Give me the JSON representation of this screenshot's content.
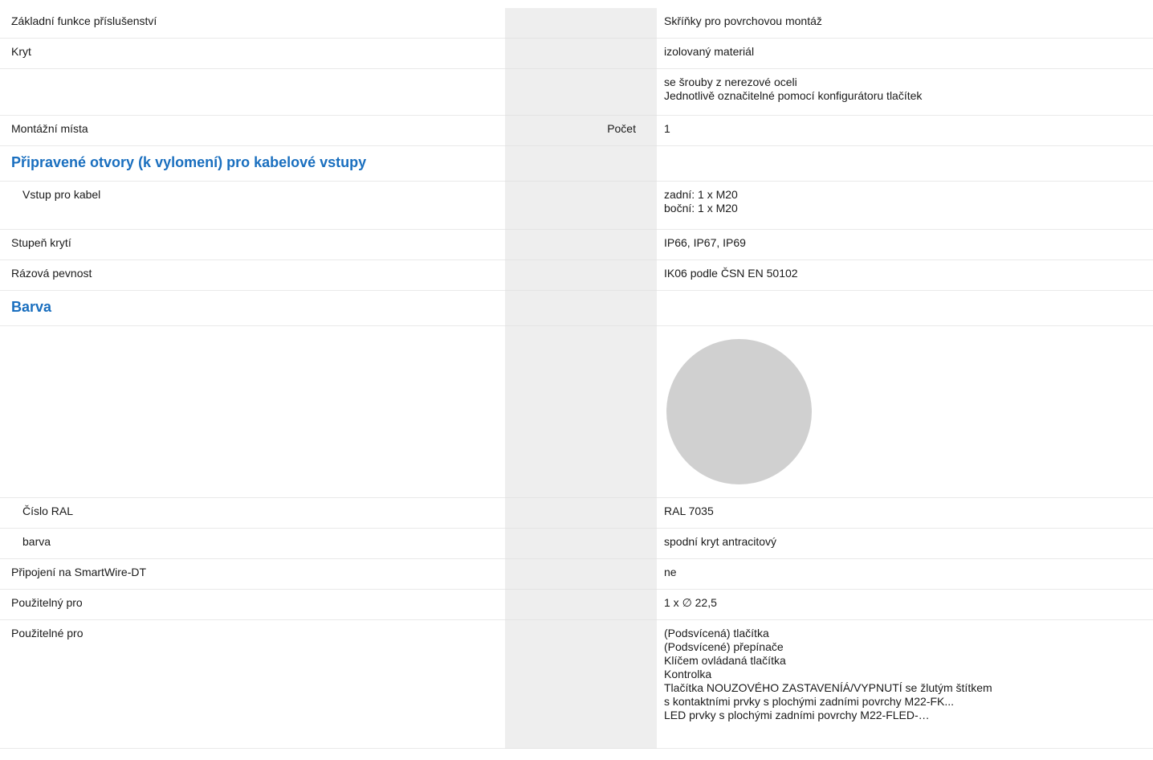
{
  "rows": [
    {
      "type": "item",
      "label": "Základní funkce příslušenství",
      "unit": "",
      "values": [
        "Skříňky pro povrchovou montáž"
      ]
    },
    {
      "type": "item",
      "label": "Kryt",
      "unit": "",
      "values": [
        "izolovaný materiál"
      ]
    },
    {
      "type": "item",
      "label": "",
      "unit": "",
      "values": [
        "se šrouby z nerezové oceli",
        "Jednotlivě označitelné pomocí konfigurátoru tlačítek"
      ]
    },
    {
      "type": "item",
      "label": "Montážní místa",
      "unit": "Počet",
      "values": [
        "1"
      ]
    },
    {
      "type": "section",
      "label": "Připravené otvory (k vylomení) pro kabelové vstupy"
    },
    {
      "type": "item",
      "indent": true,
      "label": "Vstup pro kabel",
      "unit": "",
      "values": [
        "zadní: 1 x M20",
        "boční: 1 x M20"
      ]
    },
    {
      "type": "item",
      "label": "Stupeň krytí",
      "unit": "",
      "values": [
        "IP66, IP67, IP69"
      ]
    },
    {
      "type": "item",
      "label": "Rázová pevnost",
      "unit": "",
      "values": [
        "IK06 podle ČSN EN 50102"
      ]
    },
    {
      "type": "section",
      "label": "Barva"
    },
    {
      "type": "swatch",
      "color": "#d0d0d0"
    },
    {
      "type": "item",
      "indent": true,
      "label": "Číslo RAL",
      "unit": "",
      "values": [
        "RAL 7035"
      ]
    },
    {
      "type": "item",
      "indent": true,
      "label": "barva",
      "unit": "",
      "values": [
        "spodní kryt antracitový"
      ]
    },
    {
      "type": "item",
      "label": "Připojení na SmartWire-DT",
      "unit": "",
      "values": [
        "ne"
      ]
    },
    {
      "type": "item",
      "label": "Použitelný pro",
      "unit": "",
      "values": [
        "1 x ∅ 22,5"
      ]
    },
    {
      "type": "item",
      "label": "Použitelné pro",
      "unit": "",
      "values": [
        "(Podsvícená) tlačítka",
        "(Podsvícené) přepínače",
        "Klíčem ovládaná tlačítka",
        "Kontrolka",
        "Tlačítka NOUZOVÉHO ZASTAVENÍÁ/VYPNUTÍ se žlutým štítkem",
        "s kontaktními prvky s plochými zadními povrchy M22-FK...",
        "LED prvky s plochými zadními povrchy M22-FLED-…"
      ]
    }
  ],
  "colors": {
    "accent": "#1a6fbf",
    "unit_column": "#eeeeee",
    "swatch": "#d0d0d0"
  }
}
